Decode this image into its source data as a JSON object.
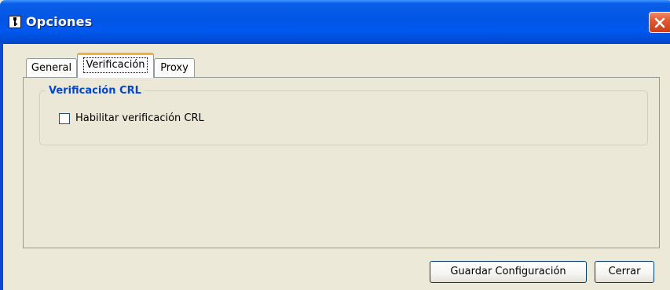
{
  "window": {
    "title": "Opciones",
    "colors": {
      "titlebar": "#0055e5",
      "background": "#ece9d8",
      "close_button": "#e2582f",
      "group_title": "#0046d5",
      "active_tab_highlight": "#f2b03a"
    }
  },
  "tabs": [
    {
      "label": "General",
      "active": false
    },
    {
      "label": "Verificación",
      "active": true
    },
    {
      "label": "Proxy",
      "active": false
    }
  ],
  "crl_group": {
    "title": "Verificación CRL",
    "checkbox_label": "Habilitar verificación CRL",
    "checked": false
  },
  "buttons": {
    "save": "Guardar Configuración",
    "close": "Cerrar"
  },
  "icons": {
    "app": "key-icon",
    "close": "close-icon"
  }
}
